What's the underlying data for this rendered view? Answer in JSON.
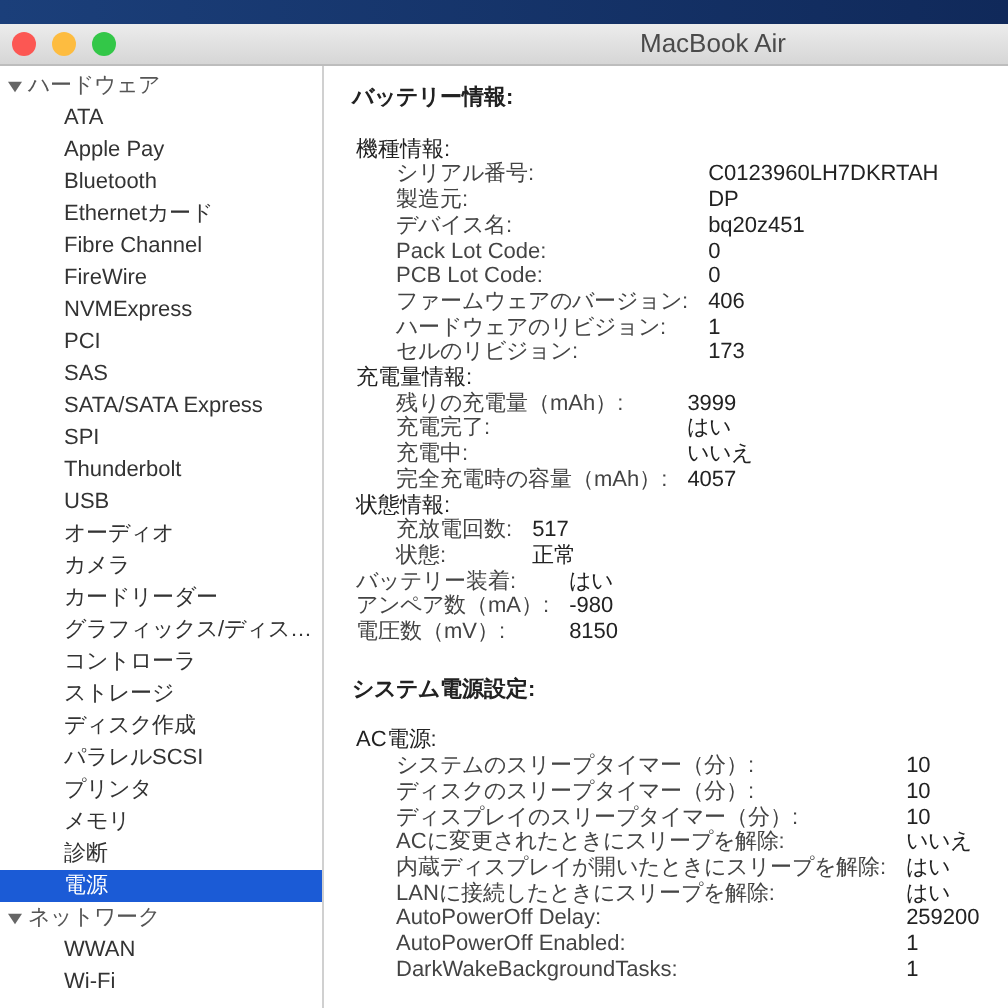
{
  "window": {
    "title": "MacBook Air"
  },
  "sidebar": {
    "groups": [
      {
        "label": "ハードウェア",
        "expanded": true,
        "items": [
          {
            "label": "ATA",
            "selected": false
          },
          {
            "label": "Apple Pay",
            "selected": false
          },
          {
            "label": "Bluetooth",
            "selected": false
          },
          {
            "label": "Ethernetカード",
            "selected": false
          },
          {
            "label": "Fibre Channel",
            "selected": false
          },
          {
            "label": "FireWire",
            "selected": false
          },
          {
            "label": "NVMExpress",
            "selected": false
          },
          {
            "label": "PCI",
            "selected": false
          },
          {
            "label": "SAS",
            "selected": false
          },
          {
            "label": "SATA/SATA Express",
            "selected": false
          },
          {
            "label": "SPI",
            "selected": false
          },
          {
            "label": "Thunderbolt",
            "selected": false
          },
          {
            "label": "USB",
            "selected": false
          },
          {
            "label": "オーディオ",
            "selected": false
          },
          {
            "label": "カメラ",
            "selected": false
          },
          {
            "label": "カードリーダー",
            "selected": false
          },
          {
            "label": "グラフィックス/ディス…",
            "selected": false
          },
          {
            "label": "コントローラ",
            "selected": false
          },
          {
            "label": "ストレージ",
            "selected": false
          },
          {
            "label": "ディスク作成",
            "selected": false
          },
          {
            "label": "パラレルSCSI",
            "selected": false
          },
          {
            "label": "プリンタ",
            "selected": false
          },
          {
            "label": "メモリ",
            "selected": false
          },
          {
            "label": "診断",
            "selected": false
          },
          {
            "label": "電源",
            "selected": true
          }
        ]
      },
      {
        "label": "ネットワーク",
        "expanded": true,
        "items": [
          {
            "label": "WWAN",
            "selected": false
          },
          {
            "label": "Wi-Fi",
            "selected": false
          }
        ]
      }
    ]
  },
  "detail": {
    "sections": [
      {
        "title": "バッテリー情報:",
        "rows": [
          {
            "label": "機種情報:",
            "children": [
              {
                "label": "シリアル番号:",
                "value": "C0123960LH7DKRTAH"
              },
              {
                "label": "製造元:",
                "value": "DP"
              },
              {
                "label": "デバイス名:",
                "value": "bq20z451"
              },
              {
                "label": "Pack Lot Code:",
                "value": "0"
              },
              {
                "label": "PCB Lot Code:",
                "value": "0"
              },
              {
                "label": "ファームウェアのバージョン:",
                "value": "406"
              },
              {
                "label": "ハードウェアのリビジョン:",
                "value": "1"
              },
              {
                "label": "セルのリビジョン:",
                "value": "173"
              }
            ]
          },
          {
            "label": "充電量情報:",
            "children": [
              {
                "label": "残りの充電量（mAh）:",
                "value": "3999"
              },
              {
                "label": "充電完了:",
                "value": "はい"
              },
              {
                "label": "充電中:",
                "value": "いいえ"
              },
              {
                "label": "完全充電時の容量（mAh）:",
                "value": "4057"
              }
            ]
          },
          {
            "label": "状態情報:",
            "children": [
              {
                "label": "充放電回数:",
                "value": "517"
              },
              {
                "label": "状態:",
                "value": "正常"
              }
            ]
          },
          {
            "label": "バッテリー装着:",
            "value": "はい"
          },
          {
            "label": "アンペア数（mA）:",
            "value": "-980"
          },
          {
            "label": "電圧数（mV）:",
            "value": "8150"
          }
        ]
      },
      {
        "title": "システム電源設定:",
        "rows": [
          {
            "label": "AC電源:",
            "children": [
              {
                "label": "システムのスリープタイマー（分）:",
                "value": "10"
              },
              {
                "label": "ディスクのスリープタイマー（分）:",
                "value": "10"
              },
              {
                "label": "ディスプレイのスリープタイマー（分）:",
                "value": "10"
              },
              {
                "label": "ACに変更されたときにスリープを解除:",
                "value": "いいえ"
              },
              {
                "label": "内蔵ディスプレイが開いたときにスリープを解除:",
                "value": "はい"
              },
              {
                "label": "LANに接続したときにスリープを解除:",
                "value": "はい"
              },
              {
                "label": "AutoPowerOff Delay:",
                "value": "259200"
              },
              {
                "label": "AutoPowerOff Enabled:",
                "value": "1"
              },
              {
                "label": "DarkWakeBackgroundTasks:",
                "value": "1"
              }
            ]
          }
        ]
      }
    ]
  }
}
